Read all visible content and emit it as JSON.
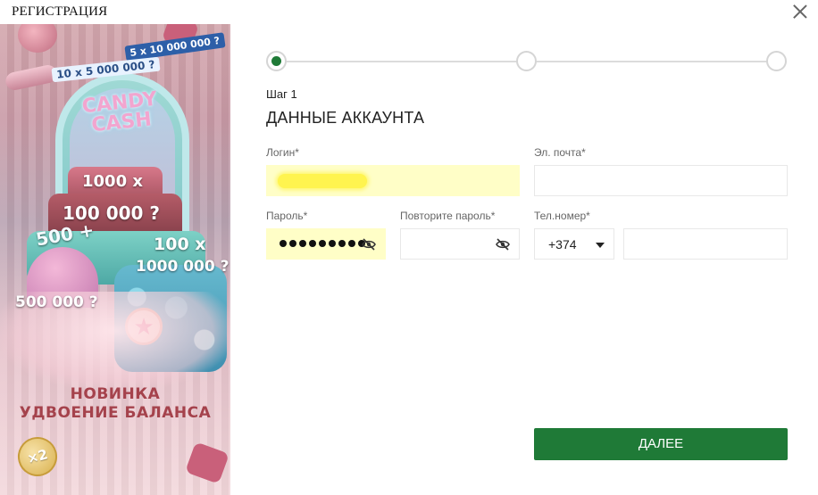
{
  "window": {
    "title": "РЕГИСТРАЦИЯ",
    "close_icon": "close-icon"
  },
  "banner": {
    "logo": "CANDY CASH",
    "badges": {
      "top_right": "5 x 10 000 000 ?",
      "top_left": "10 x 5 000 000 ?",
      "cake_top": "1000 x",
      "cake_mid": "100 000 ?",
      "cupcake_top": "500 +",
      "right_top": "100 x",
      "right_mid": "1000 000 ?",
      "left_low": "500 000 ?"
    },
    "promo_line1": "НОВИНКА",
    "promo_line2": "УДВОЕНИЕ БАЛАНСА",
    "coin": "×2"
  },
  "stepper": {
    "steps": 3,
    "active_step": 1,
    "step_label": "Шаг 1",
    "section_title": "ДАННЫЕ АККАУНТА"
  },
  "form": {
    "login": {
      "label": "Логин*",
      "value": ""
    },
    "email": {
      "label": "Эл. почта*",
      "value": ""
    },
    "password": {
      "label": "Пароль*",
      "masked_length": 9
    },
    "password_repeat": {
      "label": "Повторите пароль*",
      "value": ""
    },
    "phone": {
      "label": "Тел.номер*",
      "country_code": "+374",
      "value": ""
    }
  },
  "actions": {
    "next_label": "ДАЛЕЕ"
  },
  "colors": {
    "accent": "#1f7a37",
    "autofill": "#fffec7",
    "promo_text": "#a5424c"
  }
}
